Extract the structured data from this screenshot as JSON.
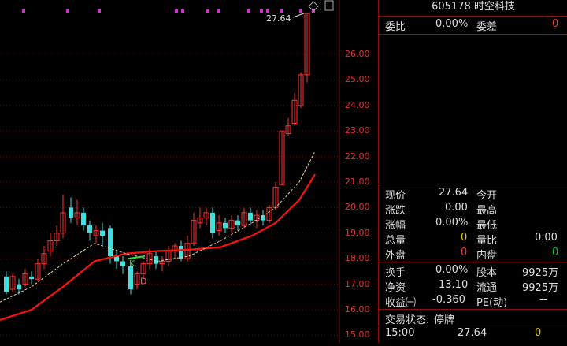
{
  "chart_data": {
    "type": "candlestick",
    "ylim": [
      15.0,
      28.0
    ],
    "price_ticks": [
      "26.00",
      "25.00",
      "24.00",
      "23.00",
      "22.00",
      "21.00",
      "20.00",
      "19.00",
      "18.00",
      "17.00",
      "16.00",
      "15.00"
    ],
    "marker_labels": {
      "high": "27.64",
      "k": "K",
      "d": "D"
    },
    "colors": {
      "up": "#ff3030",
      "down": "#40e0e0",
      "ma_main": "#ff1010",
      "ma_dashed": "#e8d090",
      "grid": "#8a1010"
    }
  },
  "quote": {
    "header": "605178 时空科技",
    "weibi_label": "委比",
    "weibi_value": "0.00%",
    "weicha_label": "委差",
    "weicha_value": "0",
    "xianjia_label": "现价",
    "xianjia_value": "27.64",
    "jinkai_label": "今开",
    "zhangdie_label": "涨跌",
    "zhangdie_value": "0.00",
    "zuigao_label": "最高",
    "zhangfu_label": "涨幅",
    "zhangfu_value": "0.00%",
    "zuidi_label": "最低",
    "zongliang_label": "总量",
    "zongliang_value": "0",
    "liangbi_label": "量比",
    "liangbi_value": "0.00",
    "waipan_label": "外盘",
    "waipan_value": "0",
    "neipan_label": "内盘",
    "neipan_value": "0",
    "huanshou_label": "换手",
    "huanshou_value": "0.00%",
    "guben_label": "股本",
    "guben_value": "9925万",
    "jingzi_label": "净资",
    "jingzi_value": "13.10",
    "liutong_label": "流通",
    "liutong_value": "9925万",
    "shouyi_label": "收益㈠",
    "shouyi_value": "-0.360",
    "pe_label": "PE(动)",
    "pe_value": "--",
    "status_label": "交易状态:",
    "status_value": "停牌",
    "tick_time": "15:00",
    "tick_price": "27.64",
    "tick_vol": "0"
  }
}
